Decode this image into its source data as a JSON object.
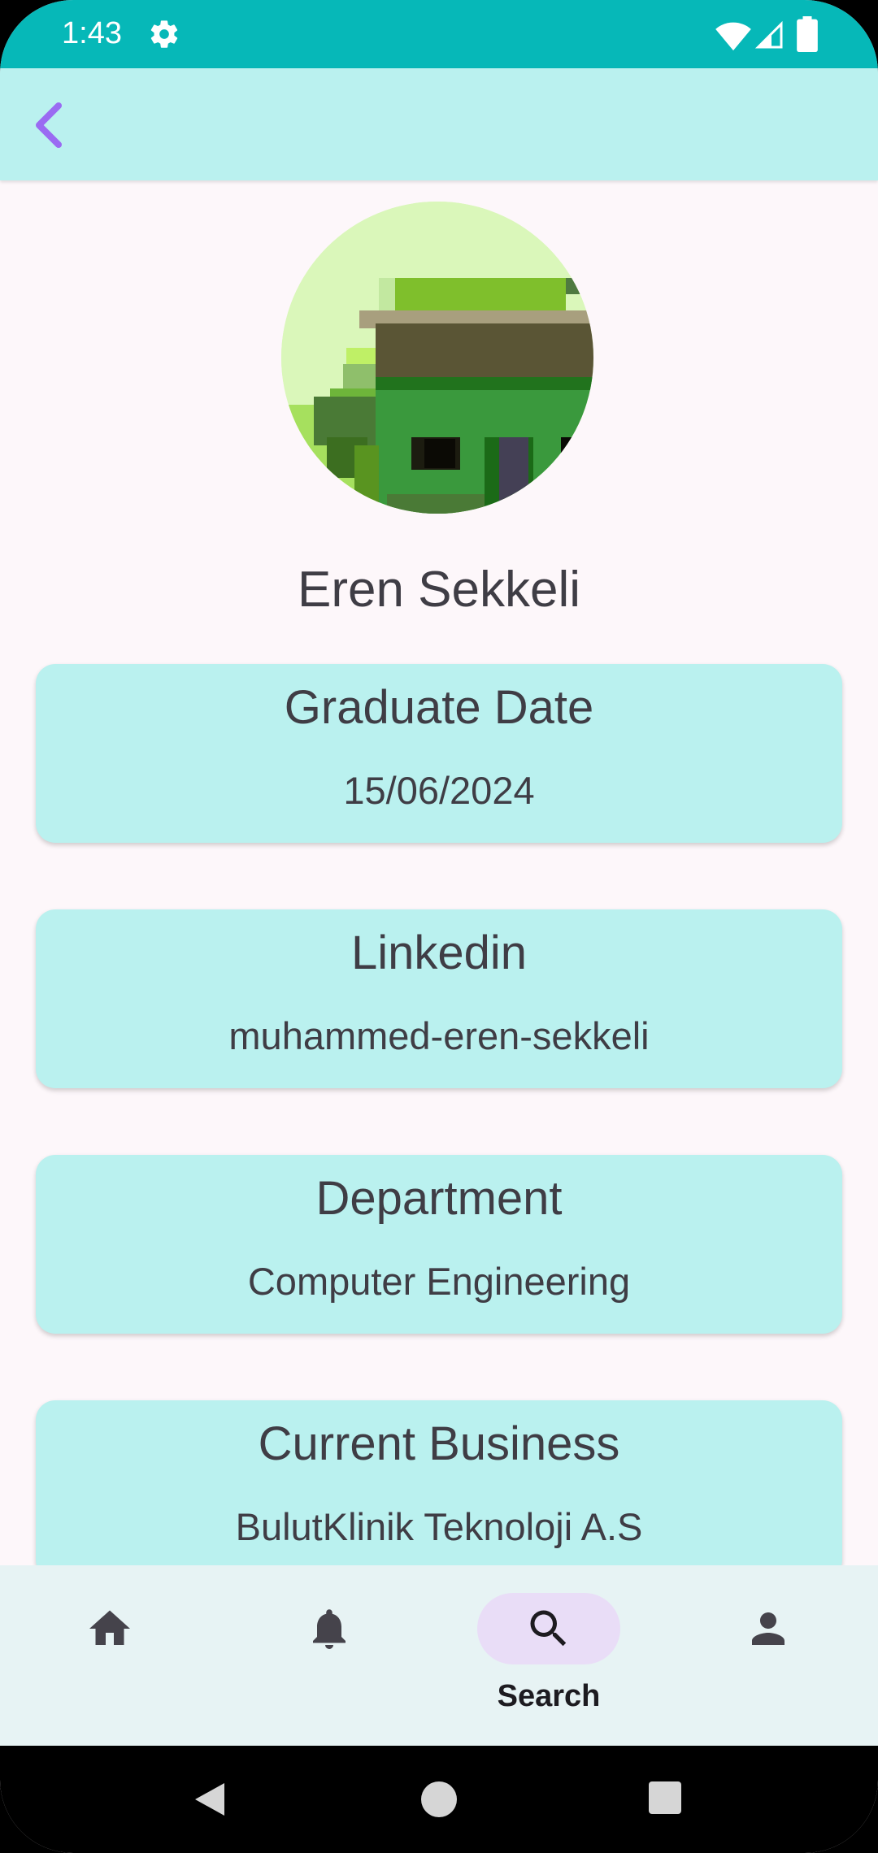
{
  "status_bar": {
    "time": "1:43"
  },
  "profile": {
    "name": "Eren Sekkeli"
  },
  "cards": [
    {
      "label": "Graduate Date",
      "value": "15/06/2024"
    },
    {
      "label": "Linkedin",
      "value": "muhammed-eren-sekkeli"
    },
    {
      "label": "Department",
      "value": "Computer Engineering"
    },
    {
      "label": "Current Business",
      "value": "BulutKlinik Teknoloji A.S"
    }
  ],
  "bottom_nav": {
    "items": [
      {
        "icon": "home-icon",
        "label": ""
      },
      {
        "icon": "bell-icon",
        "label": ""
      },
      {
        "icon": "search-icon",
        "label": "Search",
        "active": true
      },
      {
        "icon": "person-icon",
        "label": ""
      }
    ]
  },
  "colors": {
    "status_bar": "#06B8B8",
    "app_bar": "#BAF1EF",
    "card_bg": "#BAF1EF",
    "back_arrow": "#9A6BF2",
    "active_nav_pill": "#E9DDF7",
    "page_bg": "#FDF7FA"
  }
}
